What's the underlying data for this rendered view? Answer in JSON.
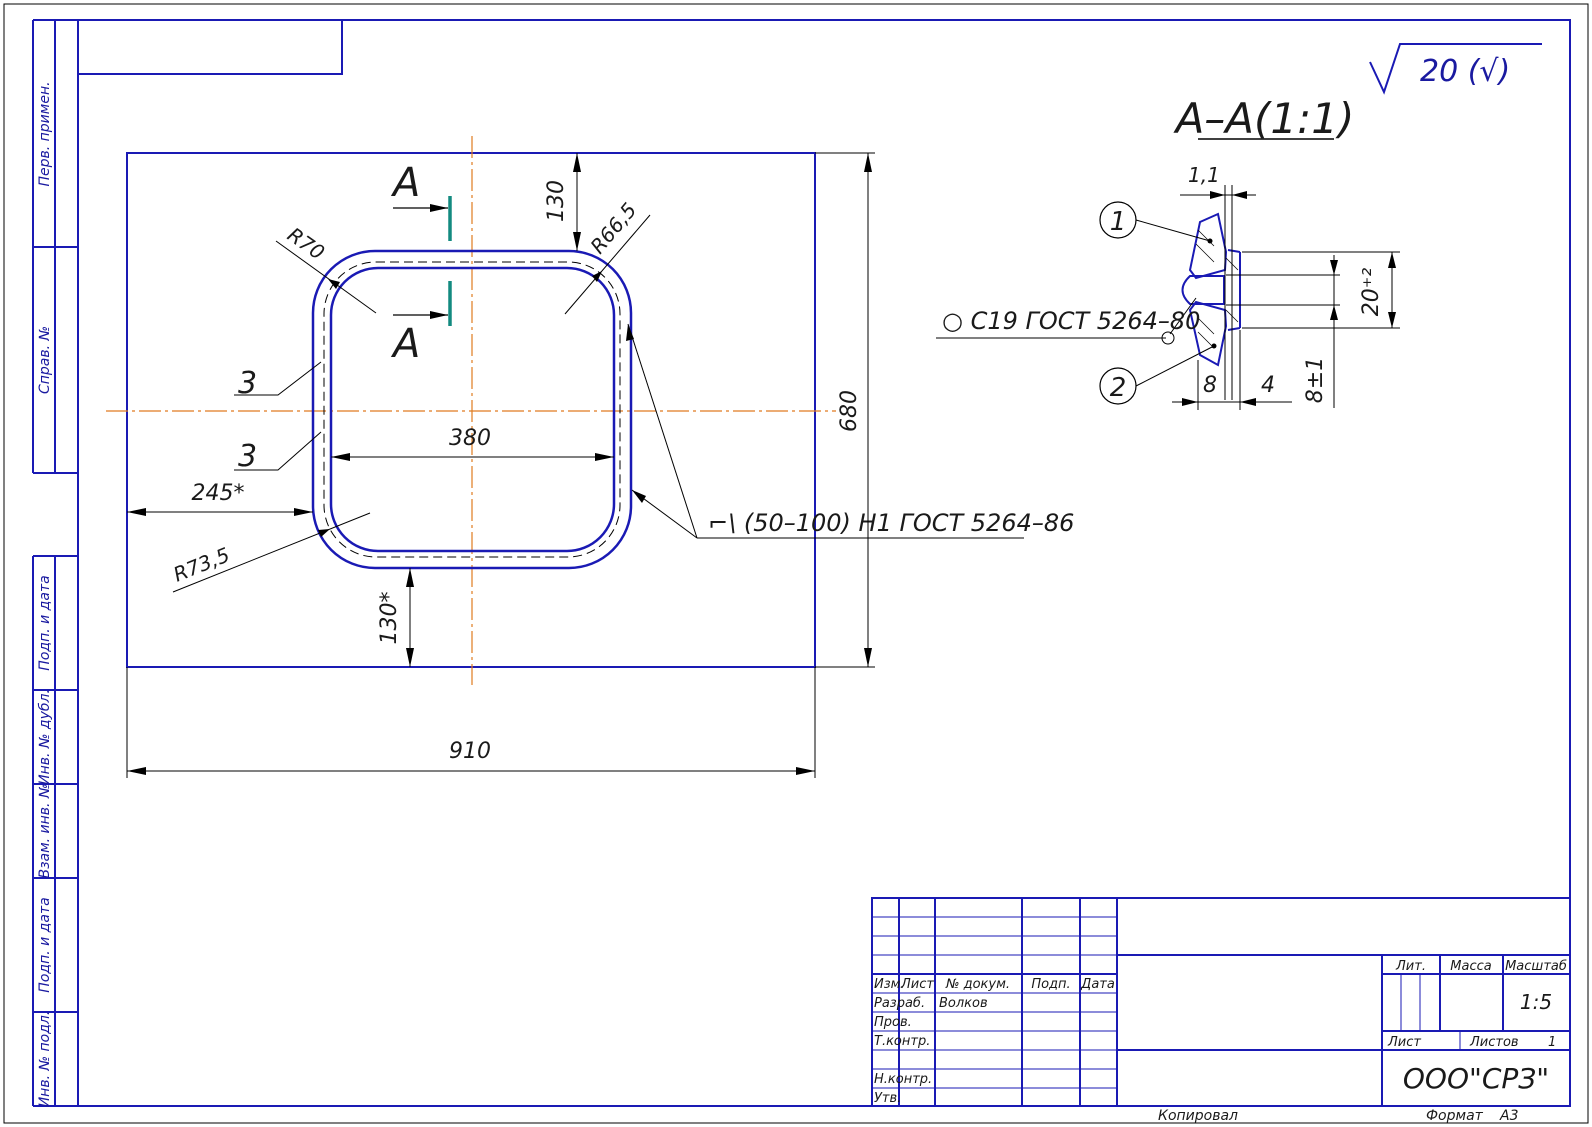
{
  "roughness": {
    "value": "20 (√)"
  },
  "section": {
    "title": "A–A(1:1)",
    "dims": {
      "gap": "1,1",
      "height": "20⁺²",
      "width_left": "8",
      "width_right": "4",
      "depth": "8±1"
    },
    "callouts": {
      "one": "1",
      "two": "2"
    },
    "weld_note": "○ С19 ГОСТ 5264–80"
  },
  "plan": {
    "cut_letter_top": "А",
    "cut_letter_bottom": "А",
    "dims": {
      "top_offset": "130",
      "r_outer": "R70",
      "r_inner": "R66,5",
      "r_bottom": "R73,5",
      "width_opening": "380",
      "left_offset": "245*",
      "bottom_offset": "130*",
      "height_total": "680",
      "width_total": "910"
    },
    "weld_labels": [
      "3",
      "3"
    ],
    "weld_note": "⌐\\ (50–100) Н1 ГОСТ 5264–86"
  },
  "side_labels": [
    "Перв. примен.",
    "Справ. №",
    "Подп. и дата",
    "Инв. № дубл.",
    "Взам. инв. №",
    "Подп. и дата",
    "Инв. № подл."
  ],
  "title_block": {
    "header": [
      "Изм.",
      "Лист",
      "№ докум.",
      "Подп.",
      "Дата"
    ],
    "roles": [
      "Разраб.",
      "Пров.",
      "Т.контр.",
      "",
      "Н.контр.",
      "Утв."
    ],
    "developer": "Волков",
    "lit_label": "Лит.",
    "mass_label": "Масса",
    "scale_label": "Масштаб",
    "scale": "1:5",
    "sheet_label": "Лист",
    "sheets_label": "Листов",
    "sheets": "1",
    "company": "ООО\"СРЗ\""
  },
  "footer": {
    "copied": "Копировал",
    "format_label": "Формат",
    "format": "А3"
  }
}
